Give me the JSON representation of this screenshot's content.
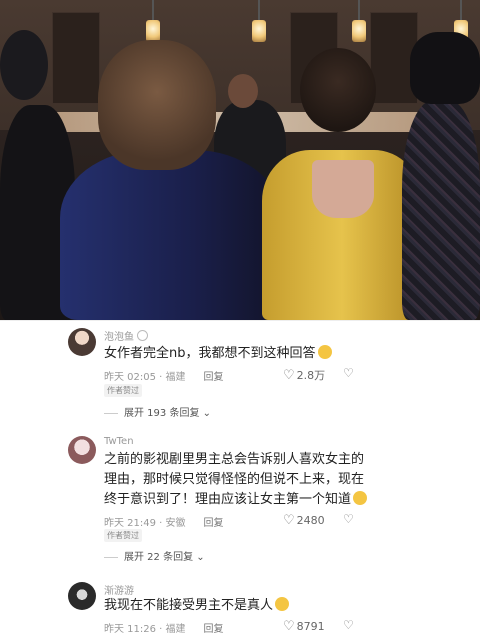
{
  "comments": [
    {
      "username": "泡泡鱼",
      "text": "女作者完全nb，我都想不到这种回答",
      "time": "昨天 02:05 · 福建",
      "reply_label": "回复",
      "likes": "2.8万",
      "badge": "作者赞过",
      "expand": "展开 193 条回复"
    },
    {
      "username": "TwTen",
      "text": "之前的影视剧里男主总会告诉别人喜欢女主的理由，那时候只觉得怪怪的但说不上来，现在终于意识到了！理由应该让女主第一个知道",
      "time": "昨天 21:49 · 安徽",
      "reply_label": "回复",
      "likes": "2480",
      "badge": "作者赞过",
      "expand": "展开 22 条回复"
    },
    {
      "username": "渐游游",
      "text": "我现在不能接受男主不是真人",
      "time": "昨天 11:26 · 福建",
      "reply_label": "回复",
      "likes": "8791"
    }
  ],
  "icons": {
    "like": "heart-icon",
    "dislike": "broken-heart-icon",
    "expand": "chevron-down-icon"
  },
  "colors": {
    "text": "#222222",
    "meta": "#999999",
    "dress": "#d9b33a"
  }
}
